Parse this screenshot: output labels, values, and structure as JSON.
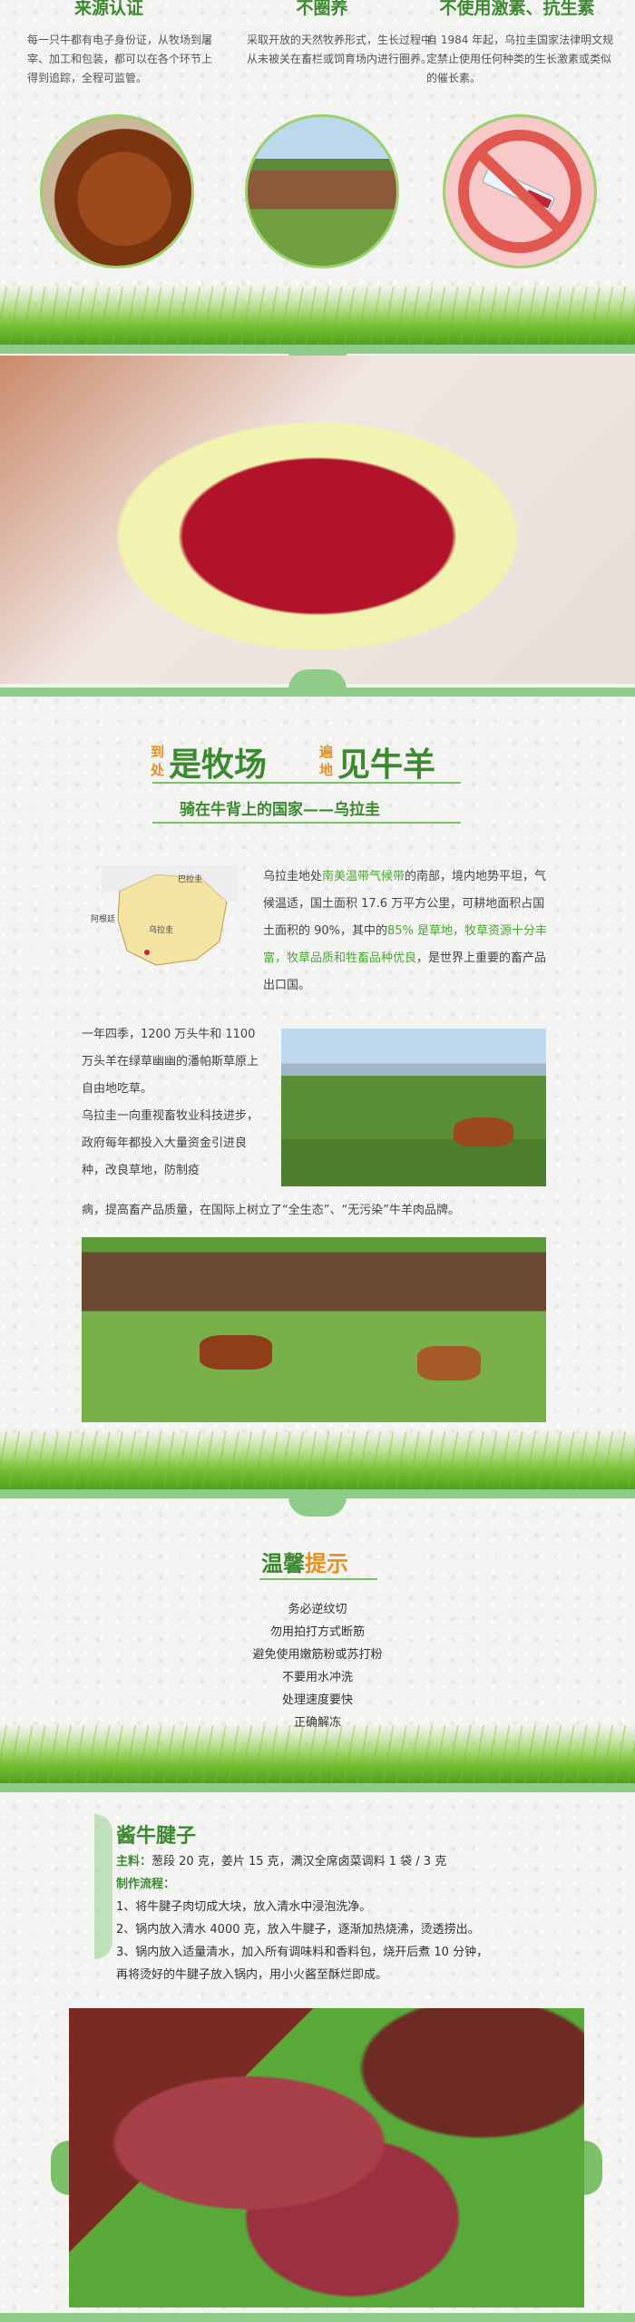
{
  "features": [
    {
      "title": "来源认证",
      "text": "每一只牛都有电子身份证，从牧场到屠宰、加工和包装，都可以在各个环节上得到追踪，全程可监管。",
      "icon": "cow-head-photo"
    },
    {
      "title": "不圈养",
      "text": "采取开放的天然牧养形式，生长过程中从未被关在畜栏或饲育场内进行圈养。",
      "icon": "herd-photo"
    },
    {
      "title": "不使用激素、抗生素",
      "text": "自 1984 年起，乌拉圭国家法律明文规定禁止使用任何种类的生长激素或类似的催长素。",
      "icon": "no-syringe-icon"
    }
  ],
  "ranch": {
    "title_small_1a": "到",
    "title_small_1b": "处",
    "title_big_1": "是牧场",
    "title_small_2a": "遍",
    "title_small_2b": "地",
    "title_big_2": "见牛羊",
    "subtitle": "骑在牛背上的国家——乌拉圭",
    "map_labels": {
      "brazil": "巴拉圭",
      "argentina": "阿根廷",
      "uruguay": "乌拉圭"
    },
    "para1_a": "乌拉圭地处",
    "para1_hl1": "南美温带气候带",
    "para1_b": "的南部，境内地势平坦，气候温适，国土面积 17.6 万平方公里，可耕地面积占国土面积的 90%，其中的",
    "para1_hl2": "85% 是草地，牧草资源十分丰富，牧草品质和牲畜品种优良",
    "para1_c": "，是世界上重要的畜产品出口国。",
    "para2": "一年四季，1200 万头牛和 1100 万头羊在绿草幽幽的潘帕斯草原上自由地吃草。",
    "para3_a": "乌拉圭一向重视畜牧业科技进步，政府每年都投入大量资金引进良种，改良草地，防制疫",
    "para3_b": "病，提高畜产品质量，在国际上树立了“全生态”、“无污染”牛羊肉品牌。"
  },
  "tips": {
    "title_a": "温馨",
    "title_b": "提示",
    "items": [
      "务必逆纹切",
      "勿用拍打方式断筋",
      "避免使用嫩筋粉或苏打粉",
      "不要用水冲洗",
      "处理速度要快",
      "正确解冻"
    ]
  },
  "recipe": {
    "title": "酱牛腱子",
    "ingredients_label": "主料：",
    "ingredients": "葱段 20 克，姜片 15 克，满汉全席卤菜调料 1 袋 / 3 克",
    "process_label": "制作流程：",
    "steps": [
      "1、将牛腱子肉切成大块，放入清水中浸泡洗净。",
      "2、锅内放入清水 4000 克，放入牛腱子，逐渐加热烧沸，烫透捞出。",
      "3、锅内放入适量清水，加入所有调味料和香料包，烧开后煮 10 分钟，",
      "再将烫好的牛腱子放入锅内，用小火酱至酥烂即成。"
    ]
  },
  "colors": {
    "accent_green": "#3c8a2f",
    "band_green": "#8fcc8a",
    "title_orange": "#e5901f"
  }
}
